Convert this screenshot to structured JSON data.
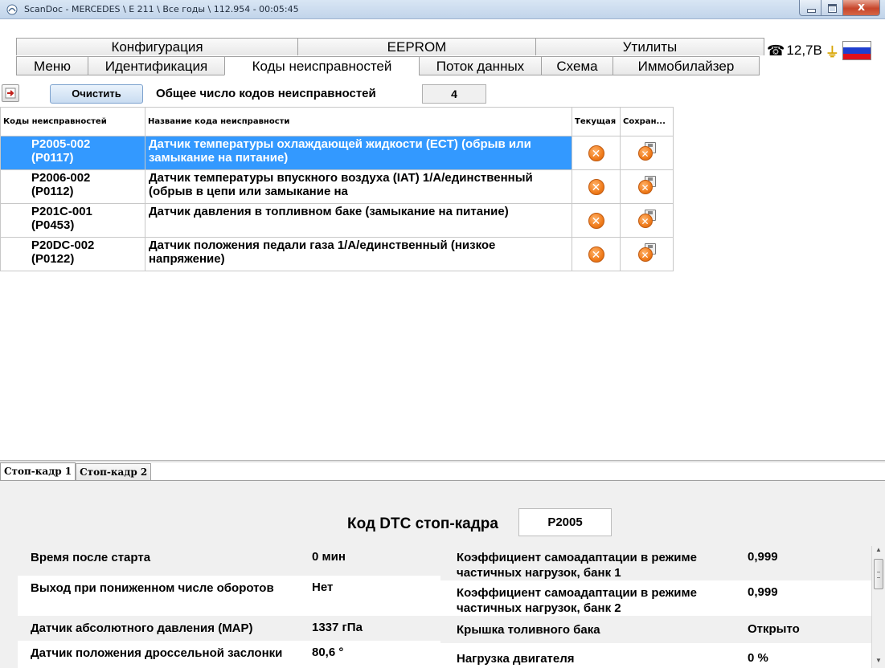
{
  "window": {
    "title": "ScanDoc - MERCEDES \\ E 211 \\ Все годы \\ 112.954 - 00:05:45",
    "close_glyph": "x"
  },
  "top_tabs": [
    "Конфигурация",
    "EEPROM",
    "Утилиты"
  ],
  "nav_tabs": [
    {
      "label": "Меню",
      "active": false
    },
    {
      "label": "Идентификация",
      "active": false
    },
    {
      "label": "Коды неисправностей",
      "active": true
    },
    {
      "label": "Поток данных",
      "active": false
    },
    {
      "label": "Схема",
      "active": false
    },
    {
      "label": "Иммобилайзер",
      "active": false
    }
  ],
  "status": {
    "phone_icon": "phone-icon",
    "voltage": "12,7В",
    "plug_icon": "plug-icon",
    "flag_colors": [
      "#ffffff",
      "#1f3fcf",
      "#e0101a"
    ]
  },
  "toolbar": {
    "clear_label": "Очистить",
    "total_label": "Общее число кодов неисправностей",
    "total_value": "4"
  },
  "dtc_table": {
    "headers": [
      "Коды неисправностей",
      "Название кода неисправности",
      "Текущая",
      "Сохран..."
    ],
    "rows": [
      {
        "code": "P2005-002",
        "obd": "(P0117)",
        "name": "Датчик температуры охлаждающей жидкости (ECT) (обрыв или замыкание на питание)",
        "selected": true
      },
      {
        "code": "P2006-002",
        "obd": "(P0112)",
        "name": "Датчик температуры впускного воздуха (IAT) 1/A/единственный (обрыв в цепи или замыкание на",
        "selected": false
      },
      {
        "code": "P201C-001",
        "obd": "(P0453)",
        "name": "Датчик давления в топливном баке (замыкание на питание)",
        "selected": false
      },
      {
        "code": "P20DC-002",
        "obd": "(P0122)",
        "name": "Датчик положения педали газа 1/A/единственный (низкое напряжение)",
        "selected": false
      }
    ],
    "status_glyph": "✕"
  },
  "freeze_frame": {
    "tabs": [
      "Стоп-кадр 1",
      "Стоп-кадр 2"
    ],
    "dtc_label": "Код DTC стоп-кадра",
    "dtc_value": "P2005",
    "left": [
      {
        "name": "Время после старта",
        "value": "0 мин"
      },
      {
        "name": "Выход при пониженном числе оборотов",
        "value": "Нет"
      },
      {
        "name": "Датчик абсолютного давления (MAP)",
        "value": "1337 гПа"
      },
      {
        "name": "Датчик положения дроссельной заслонки",
        "value": "80,6 °"
      }
    ],
    "right": [
      {
        "name": "Коэффициент самоадаптации в режиме частичных нагрузок, банк 1",
        "value": "0,999"
      },
      {
        "name": "Коэффициент самоадаптации в режиме частичных нагрузок, банк 2",
        "value": "0,999"
      },
      {
        "name": "Крышка толивного бака",
        "value": "Открыто"
      },
      {
        "name": "Нагрузка двигателя",
        "value": "0 %"
      }
    ]
  },
  "scrollbar": {
    "up": "▲",
    "down": "▼"
  }
}
